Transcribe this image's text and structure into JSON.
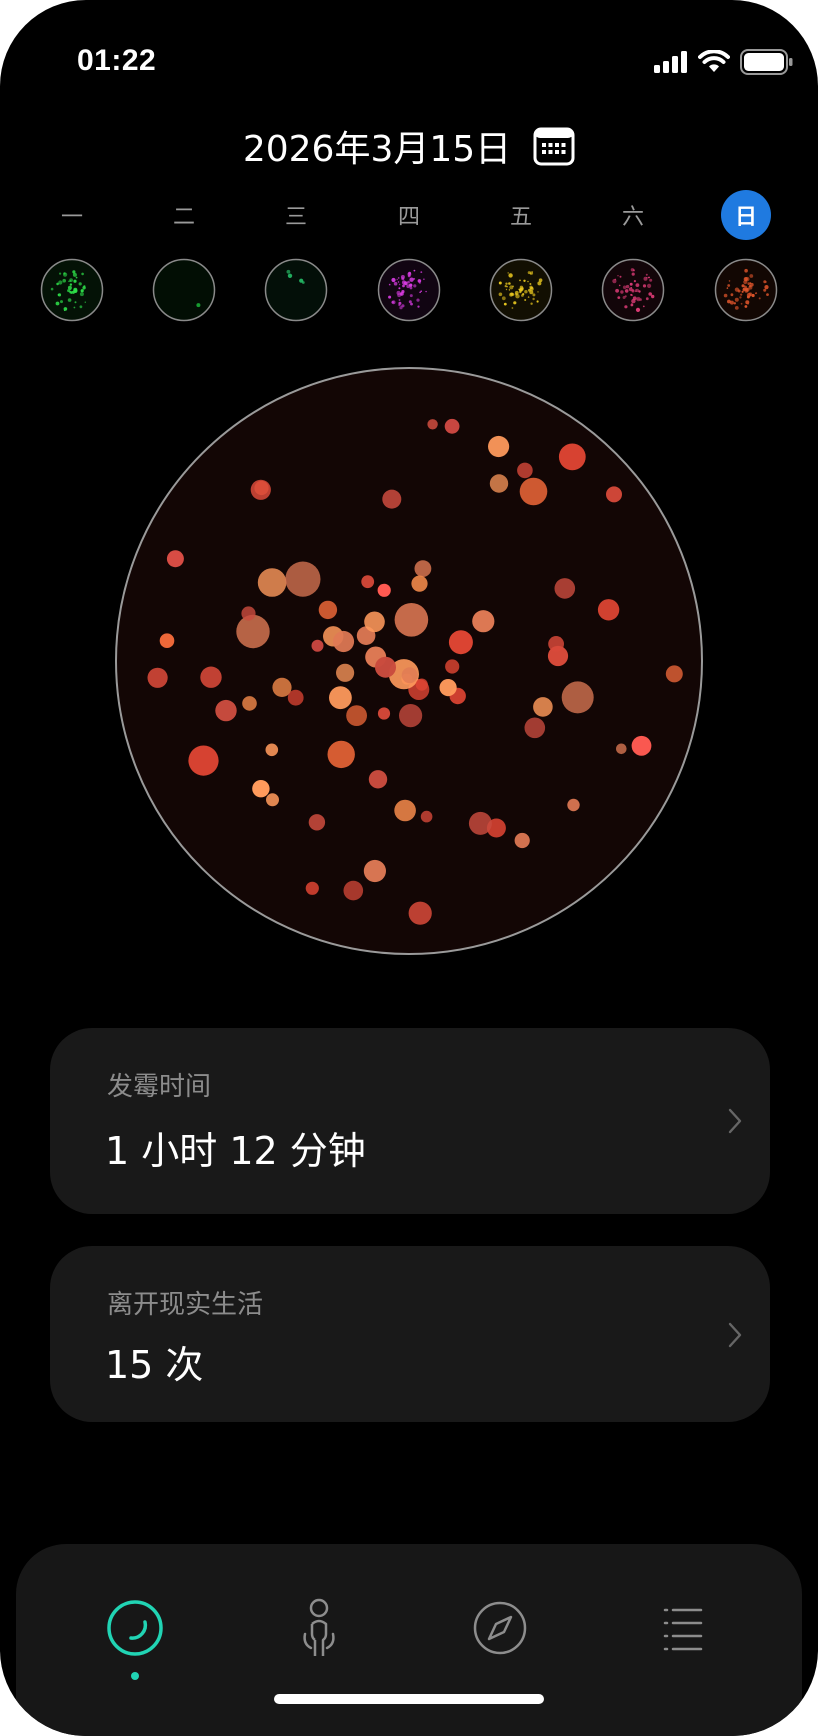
{
  "status": {
    "time": "01:22"
  },
  "header": {
    "date": "2026年3月15日"
  },
  "week": {
    "days": [
      "一",
      "二",
      "三",
      "四",
      "五",
      "六",
      "日"
    ],
    "selected_index": 6,
    "selected_color": "#1f7ae0",
    "dish_colors": [
      "#2ee04a",
      "#1bb238",
      "#27c46b",
      "#d63be0",
      "#e6c51f",
      "#e03c78",
      "#e0552b"
    ]
  },
  "main_dish": {
    "palette": [
      "#ff9a5c",
      "#e24634",
      "#f0884a",
      "#d94a3a",
      "#ff5a52",
      "#c94b3e",
      "#f26a3a",
      "#e07a55"
    ]
  },
  "cards": [
    {
      "label": "发霉时间",
      "value": "1 小时 12 分钟"
    },
    {
      "label": "离开现实生活",
      "value": "15 次"
    }
  ],
  "tabs": [
    {
      "name": "ring-tab",
      "active": true
    },
    {
      "name": "person-tab",
      "active": false
    },
    {
      "name": "compass-tab",
      "active": false
    },
    {
      "name": "list-tab",
      "active": false
    }
  ],
  "accent": "#21d4b4"
}
